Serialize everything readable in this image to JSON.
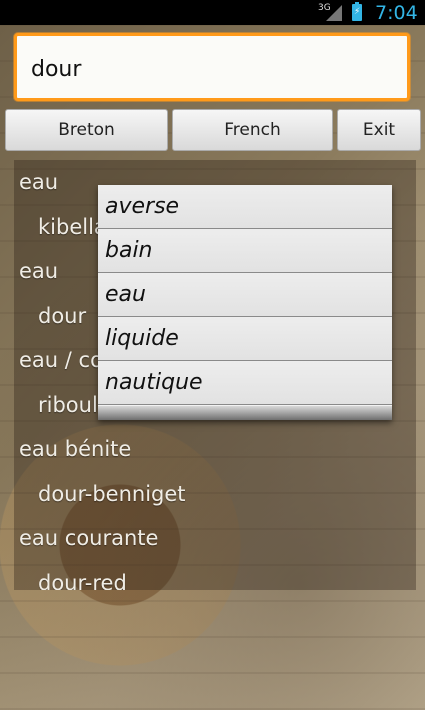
{
  "status_bar": {
    "network": "3G",
    "time": "7:04",
    "accent_color": "#33b5e5"
  },
  "search": {
    "value": "dour",
    "border_color": "#ff9a1a"
  },
  "buttons": {
    "breton": "Breton",
    "french": "French",
    "exit": "Exit"
  },
  "results": [
    {
      "type": "term",
      "text": "eau"
    },
    {
      "type": "trans",
      "text": "kibella"
    },
    {
      "type": "term",
      "text": "eau"
    },
    {
      "type": "trans",
      "text": "dour"
    },
    {
      "type": "term",
      "text": "eau / co"
    },
    {
      "type": "trans",
      "text": "riboul"
    },
    {
      "type": "term",
      "text": "eau bénite"
    },
    {
      "type": "trans",
      "text": "dour-benniget"
    },
    {
      "type": "term",
      "text": "eau courante"
    },
    {
      "type": "trans",
      "text": "dour-red"
    }
  ],
  "suggestions": [
    "averse",
    "bain",
    "eau",
    "liquide",
    "nautique"
  ]
}
